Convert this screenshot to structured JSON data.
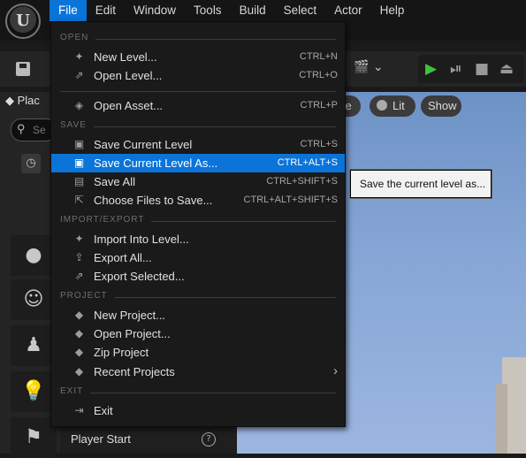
{
  "menubar": {
    "items": [
      "File",
      "Edit",
      "Window",
      "Tools",
      "Build",
      "Select",
      "Actor",
      "Help"
    ],
    "active": "File"
  },
  "left_panel": {
    "tab_label": "Plac",
    "search_placeholder": "Se",
    "player_start_label": "Player Start"
  },
  "viewport": {
    "pills": [
      "ve",
      "Lit",
      "Show"
    ]
  },
  "file_menu": {
    "sections": [
      {
        "label": "OPEN",
        "items": [
          {
            "label": "New Level...",
            "shortcut": "CTRL+N",
            "icon": "new-level-icon"
          },
          {
            "label": "Open Level...",
            "shortcut": "CTRL+O",
            "icon": "open-level-icon"
          }
        ]
      },
      {
        "label": "",
        "items": [
          {
            "label": "Open Asset...",
            "shortcut": "CTRL+P",
            "icon": "open-asset-icon"
          }
        ]
      },
      {
        "label": "SAVE",
        "items": [
          {
            "label": "Save Current Level",
            "shortcut": "CTRL+S",
            "icon": "save-icon"
          },
          {
            "label": "Save Current Level As...",
            "shortcut": "CTRL+ALT+S",
            "icon": "save-as-icon",
            "selected": true
          },
          {
            "label": "Save All",
            "shortcut": "CTRL+SHIFT+S",
            "icon": "save-all-icon"
          },
          {
            "label": "Choose Files to Save...",
            "shortcut": "CTRL+ALT+SHIFT+S",
            "icon": "choose-files-icon"
          }
        ]
      },
      {
        "label": "IMPORT/EXPORT",
        "items": [
          {
            "label": "Import Into Level...",
            "shortcut": "",
            "icon": "import-icon"
          },
          {
            "label": "Export All...",
            "shortcut": "",
            "icon": "export-icon"
          },
          {
            "label": "Export Selected...",
            "shortcut": "",
            "icon": "export-selected-icon"
          }
        ]
      },
      {
        "label": "PROJECT",
        "items": [
          {
            "label": "New Project...",
            "shortcut": "",
            "icon": "new-project-icon"
          },
          {
            "label": "Open Project...",
            "shortcut": "",
            "icon": "open-project-icon"
          },
          {
            "label": "Zip Project",
            "shortcut": "",
            "icon": "zip-project-icon"
          },
          {
            "label": "Recent Projects",
            "shortcut": "",
            "icon": "recent-projects-icon",
            "submenu": true
          }
        ]
      },
      {
        "label": "EXIT",
        "items": [
          {
            "label": "Exit",
            "shortcut": "",
            "icon": "exit-icon"
          }
        ]
      }
    ]
  },
  "tooltip": {
    "text": "Save the current level as..."
  },
  "colors": {
    "accent": "#0a74d9",
    "menu_bg": "#1a1a1a",
    "sky": "#86a6d6",
    "play": "#3ec23e"
  }
}
